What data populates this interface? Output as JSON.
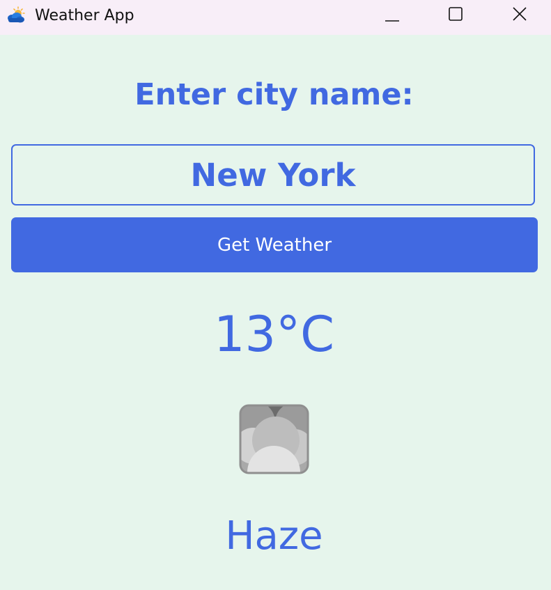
{
  "window": {
    "title": "Weather App",
    "icons": {
      "app": "weather-cloud-sun-icon",
      "minimize": "minimize-icon",
      "maximize": "maximize-icon",
      "close": "close-icon"
    }
  },
  "form": {
    "heading": "Enter city name:",
    "city_value": "New York",
    "button_label": "Get Weather"
  },
  "result": {
    "temperature": "13°C",
    "icon": "haze-cloud-icon",
    "description": "Haze"
  },
  "colors": {
    "accent": "#4169e1",
    "background": "#e6f5ec",
    "titlebar": "#f8eef8",
    "button_text": "#ffffff"
  }
}
